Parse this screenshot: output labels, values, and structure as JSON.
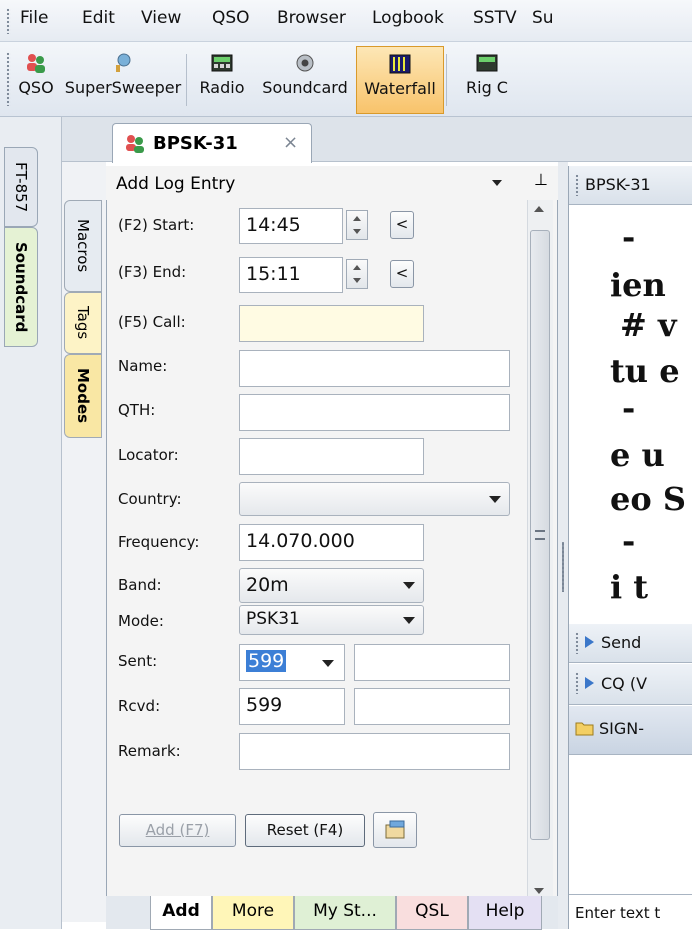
{
  "menu": {
    "items": [
      "File",
      "Edit",
      "View",
      "QSO",
      "Browser",
      "Logbook",
      "SSTV",
      "Su"
    ]
  },
  "toolbar": {
    "buttons": [
      {
        "label": "QSO",
        "icon": "qso-people-icon"
      },
      {
        "label": "SuperSweeper",
        "icon": "supersweeper-antenna-icon"
      },
      {
        "label": "Radio",
        "icon": "radio-icon"
      },
      {
        "label": "Soundcard",
        "icon": "soundcard-speaker-icon"
      },
      {
        "label": "Waterfall",
        "icon": "waterfall-icon",
        "active": true
      },
      {
        "label": "Rig C",
        "icon": "rig-control-icon"
      }
    ],
    "active_color": "#f8c36b"
  },
  "left_tabs": {
    "ft857": "FT-857",
    "soundcard": "Soundcard"
  },
  "inner_tabs": {
    "macros": "Macros",
    "tags": "Tags",
    "modes": "Modes"
  },
  "doc_tab": {
    "title": "BPSK-31",
    "close": "×"
  },
  "panel": {
    "title": "Add Log Entry",
    "start": {
      "label": "(F2) Start:",
      "value": "14:45",
      "now": "<"
    },
    "end": {
      "label": "(F3) End:",
      "value": "15:11",
      "now": "<"
    },
    "call": {
      "label": "(F5) Call:",
      "value": ""
    },
    "name": {
      "label": "Name:",
      "value": ""
    },
    "qth": {
      "label": "QTH:",
      "value": ""
    },
    "locator": {
      "label": "Locator:",
      "value": ""
    },
    "country": {
      "label": "Country:",
      "value": ""
    },
    "frequency": {
      "label": "Frequency:",
      "value": "14.070.000"
    },
    "band": {
      "label": "Band:",
      "value": "20m"
    },
    "mode": {
      "label": "Mode:",
      "value": "PSK31"
    },
    "sent": {
      "label": "Sent:",
      "value": "599",
      "extra": ""
    },
    "rcvd": {
      "label": "Rcvd:",
      "value": "599",
      "extra": ""
    },
    "remark": {
      "label": "Remark:",
      "value": ""
    },
    "add_button": "Add (F7)",
    "reset_button": "Reset (F4)",
    "call_bg": "#fffbe3"
  },
  "bottom_tabs": [
    {
      "label": "Add",
      "color": "#ffffff"
    },
    {
      "label": "More",
      "color": "#fff6b8"
    },
    {
      "label": "My St...",
      "color": "#dff0d5"
    },
    {
      "label": "QSL",
      "color": "#f9dede"
    },
    {
      "label": "Help",
      "color": "#e4e0f3"
    }
  ],
  "right": {
    "header": "BPSK-31",
    "lines": [
      "-",
      "ien",
      "# v",
      "tu e",
      "-",
      "e u",
      "eo S",
      "-",
      "i  t"
    ],
    "send": "Send",
    "cq": "CQ (V",
    "sign": "SIGN-",
    "input_hint": "Enter text t"
  }
}
